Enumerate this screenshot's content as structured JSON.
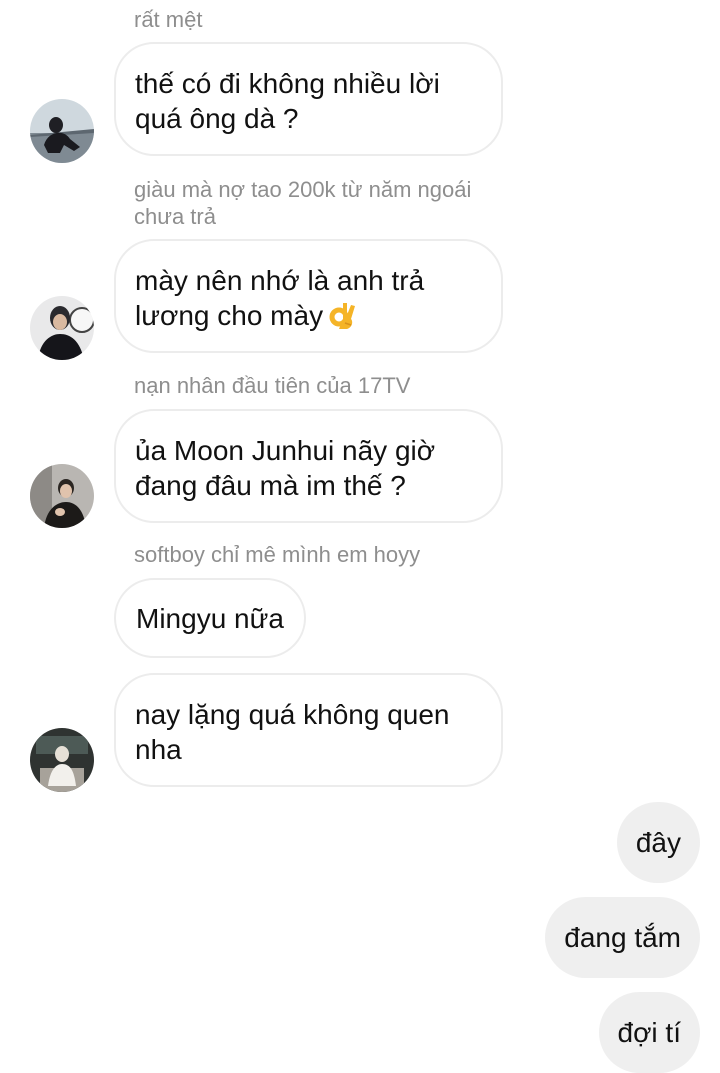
{
  "thread": {
    "messages": [
      {
        "sender": "rất mệt",
        "text": "thế có đi không nhiều lời quá ông dà ?"
      },
      {
        "sender": "giàu mà nợ tao 200k từ năm ngoái chưa trả",
        "text": "mày nên nhớ là anh trả lương cho mày"
      },
      {
        "sender": "nạn nhân đầu tiên của 17TV",
        "text": "ủa Moon Junhui nãy giờ đang đâu mà im thế ?"
      },
      {
        "sender": "softboy chỉ mê mình em hoyy",
        "text": "Mingyu nữa"
      },
      {
        "text": "nay lặng quá không quen nha"
      }
    ],
    "outgoing": [
      {
        "text": "đây"
      },
      {
        "text": "đang tắm"
      },
      {
        "text": "đợi tí"
      }
    ]
  },
  "icons": {
    "ok_hand": "ok-hand-emoji"
  },
  "colors": {
    "sender_label": "#8e8e8e",
    "incoming_border": "#ececec",
    "outgoing_bg": "#efefef",
    "text": "#111111"
  }
}
